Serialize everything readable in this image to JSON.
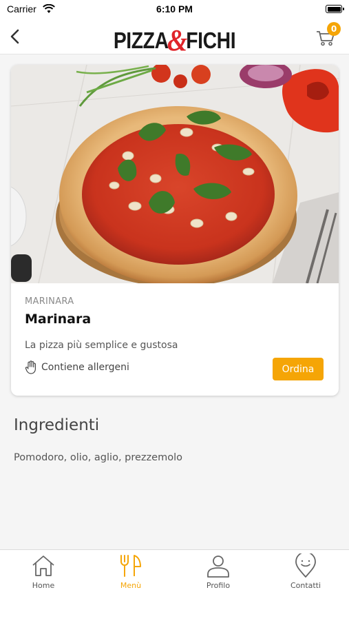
{
  "status_bar": {
    "carrier": "Carrier",
    "time": "6:10 PM"
  },
  "nav": {
    "logo_left": "PIZZA",
    "logo_amp": "&",
    "logo_right": "FICHI",
    "cart_count": "0"
  },
  "product": {
    "category": "MARINARA",
    "name": "Marinara",
    "description": "La pizza più semplice e gustosa",
    "allergens_label": "Contiene allergeni",
    "order_label": "Ordina"
  },
  "ingredients": {
    "title": "Ingredienti",
    "text": "Pomodoro, olio, aglio, prezzemolo"
  },
  "tabs": [
    {
      "label": "Home",
      "icon": "home-icon",
      "active": false
    },
    {
      "label": "Menù",
      "icon": "cutlery-icon",
      "active": true
    },
    {
      "label": "Profilo",
      "icon": "user-icon",
      "active": false
    },
    {
      "label": "Contatti",
      "icon": "location-pin-icon",
      "active": false
    }
  ],
  "colors": {
    "accent": "#f5a506",
    "logo_red": "#e0242a"
  }
}
